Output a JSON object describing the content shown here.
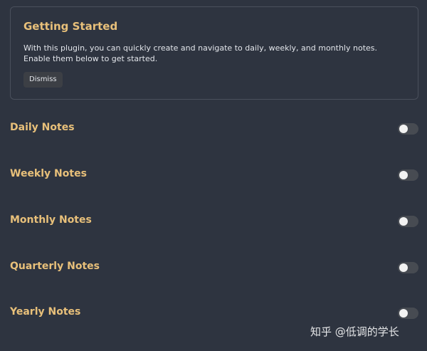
{
  "banner": {
    "title": "Getting Started",
    "text": "With this plugin, you can quickly create and navigate to daily, weekly, and monthly notes. Enable them below to get started.",
    "dismiss_label": "Dismiss"
  },
  "settings": [
    {
      "label": "Daily Notes",
      "enabled": false
    },
    {
      "label": "Weekly Notes",
      "enabled": false
    },
    {
      "label": "Monthly Notes",
      "enabled": false
    },
    {
      "label": "Quarterly Notes",
      "enabled": false
    },
    {
      "label": "Yearly Notes",
      "enabled": false
    }
  ],
  "watermark": "知乎 @低调的学长",
  "colors": {
    "background": "#2e3440",
    "accent": "#e8c07a",
    "text": "#e2e5ea",
    "toggle_off": "#474b52"
  }
}
